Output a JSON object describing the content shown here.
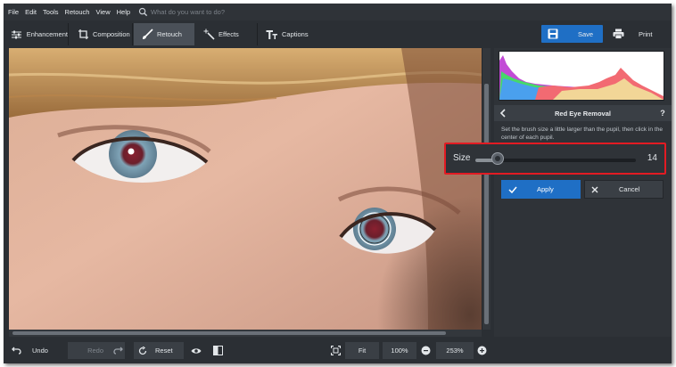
{
  "menu": {
    "items": [
      "File",
      "Edit",
      "Tools",
      "Retouch",
      "View",
      "Help"
    ],
    "search_placeholder": "What do you want to do?"
  },
  "toolbar": {
    "tabs": [
      {
        "label": "Enhancement",
        "icon": "sliders-icon"
      },
      {
        "label": "Composition",
        "icon": "crop-icon"
      },
      {
        "label": "Retouch",
        "icon": "brush-icon",
        "active": true
      },
      {
        "label": "Effects",
        "icon": "magic-wand-icon"
      },
      {
        "label": "Captions",
        "icon": "text-icon"
      }
    ],
    "save_label": "Save",
    "print_label": "Print"
  },
  "panel": {
    "title": "Red Eye Removal",
    "help_label": "?",
    "instructions": "Set the brush size a little larger than the pupil, then click in the center of each pupil.",
    "size_label": "Size",
    "size_value": "14",
    "size_fraction": 0.14,
    "apply_label": "Apply",
    "cancel_label": "Cancel"
  },
  "bottom": {
    "undo_label": "Undo",
    "redo_label": "Redo",
    "reset_label": "Reset",
    "fit_label": "Fit",
    "zoom_100_label": "100%",
    "zoom_current": "253%"
  },
  "colors": {
    "accent": "#1f6fc5",
    "highlight": "#e31b23",
    "background": "#2b2f34"
  }
}
